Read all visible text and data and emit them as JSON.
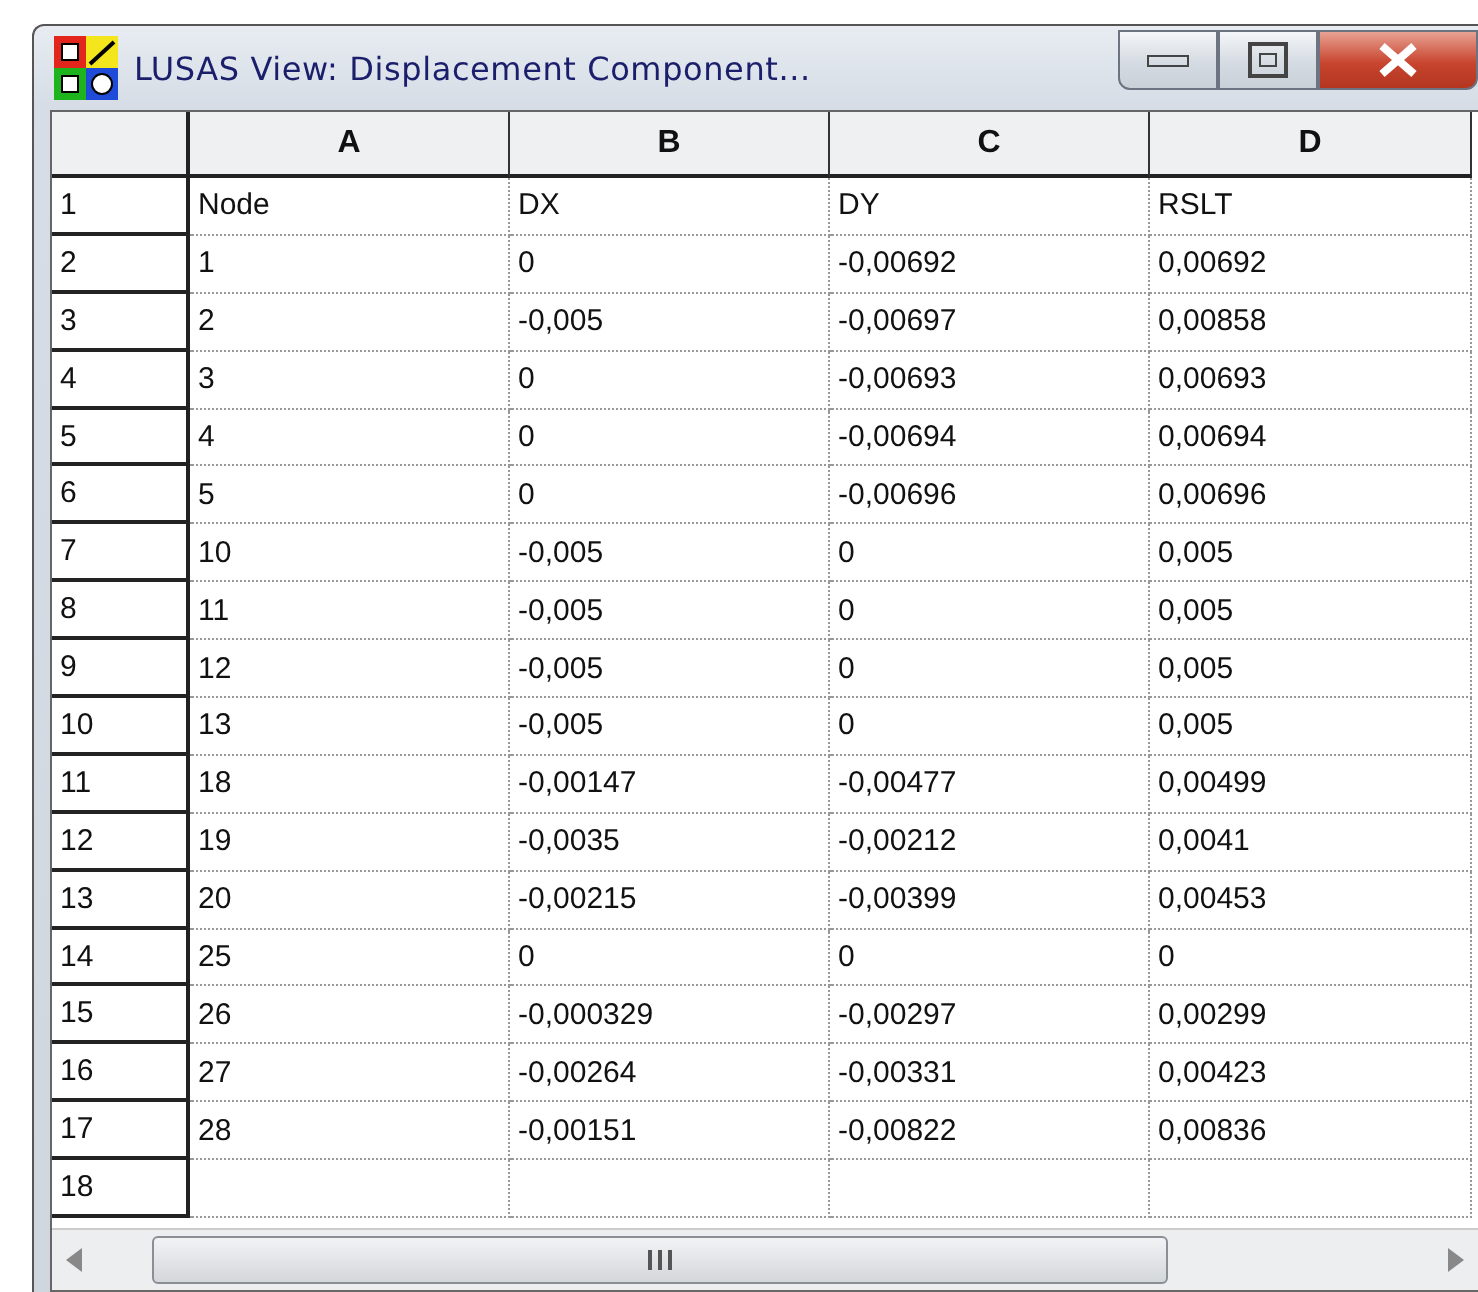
{
  "window": {
    "title": "LUSAS View: Displacement Component..."
  },
  "table": {
    "columns": [
      "A",
      "B",
      "C",
      "D"
    ],
    "rows": [
      {
        "number": "1",
        "cells": [
          "Node",
          "DX",
          "DY",
          "RSLT"
        ]
      },
      {
        "number": "2",
        "cells": [
          "1",
          "0",
          "-0,00692",
          "0,00692"
        ]
      },
      {
        "number": "3",
        "cells": [
          "2",
          "-0,005",
          "-0,00697",
          "0,00858"
        ]
      },
      {
        "number": "4",
        "cells": [
          "3",
          "0",
          "-0,00693",
          "0,00693"
        ]
      },
      {
        "number": "5",
        "cells": [
          "4",
          "0",
          "-0,00694",
          "0,00694"
        ]
      },
      {
        "number": "6",
        "cells": [
          "5",
          "0",
          "-0,00696",
          "0,00696"
        ]
      },
      {
        "number": "7",
        "cells": [
          "10",
          "-0,005",
          "0",
          "0,005"
        ]
      },
      {
        "number": "8",
        "cells": [
          "11",
          "-0,005",
          "0",
          "0,005"
        ]
      },
      {
        "number": "9",
        "cells": [
          "12",
          "-0,005",
          "0",
          "0,005"
        ]
      },
      {
        "number": "10",
        "cells": [
          "13",
          "-0,005",
          "0",
          "0,005"
        ]
      },
      {
        "number": "11",
        "cells": [
          "18",
          "-0,00147",
          "-0,00477",
          "0,00499"
        ]
      },
      {
        "number": "12",
        "cells": [
          "19",
          "-0,0035",
          "-0,00212",
          "0,0041"
        ]
      },
      {
        "number": "13",
        "cells": [
          "20",
          "-0,00215",
          "-0,00399",
          "0,00453"
        ]
      },
      {
        "number": "14",
        "cells": [
          "25",
          "0",
          "0",
          "0"
        ]
      },
      {
        "number": "15",
        "cells": [
          "26",
          "-0,000329",
          "-0,00297",
          "0,00299"
        ]
      },
      {
        "number": "16",
        "cells": [
          "27",
          "-0,00264",
          "-0,00331",
          "0,00423"
        ]
      },
      {
        "number": "17",
        "cells": [
          "28",
          "-0,00151",
          "-0,00822",
          "0,00836"
        ]
      },
      {
        "number": "18",
        "cells": [
          "",
          "",
          "",
          ""
        ]
      }
    ]
  }
}
